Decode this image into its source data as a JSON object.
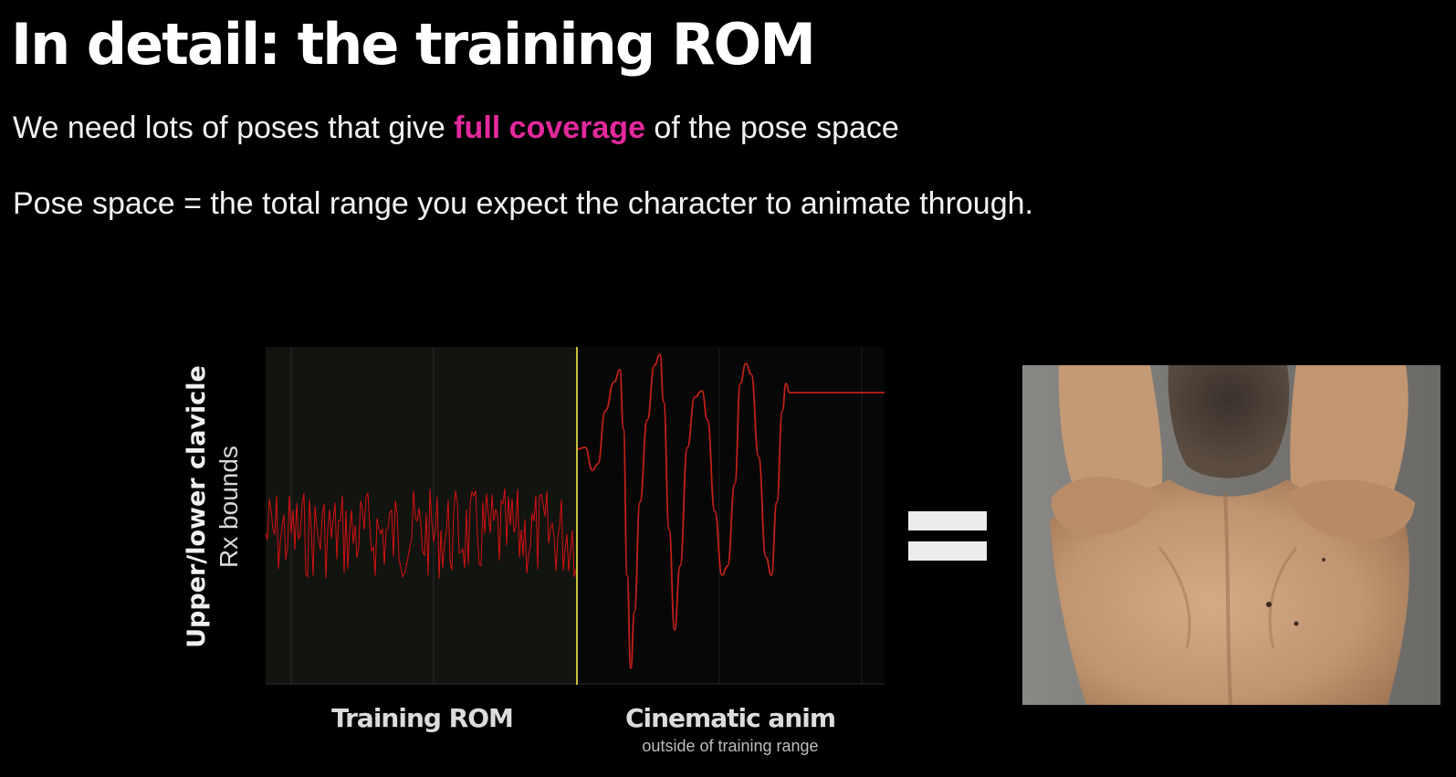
{
  "title": "In detail: the training ROM",
  "line1": {
    "before": "We need lots of poses that give ",
    "highlight": "full coverage",
    "after": " of the pose space"
  },
  "line2": "Pose space = the total range you expect the character to animate through.",
  "plot": {
    "ylabel_bold": "Upper/lower clavicle",
    "ylabel_light": "Rx bounds",
    "segment_left_label": "Training ROM",
    "segment_right_label": "Cinematic anim",
    "segment_right_sublabel": "outside of training range",
    "colors": {
      "signal": "#d31212",
      "divider": "#c8c13a",
      "plot_background": "#101010"
    }
  },
  "equals_sign": "=",
  "photo": {
    "subject": "muscular back with arms raised overhead",
    "background_color": "#7a7874",
    "skin_color": "#c59c76"
  }
}
